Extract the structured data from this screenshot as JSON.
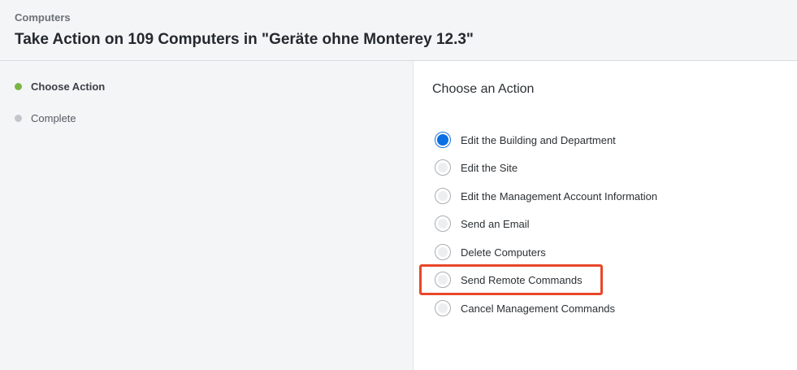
{
  "header": {
    "breadcrumb": "Computers",
    "title": "Take Action on 109 Computers in \"Geräte ohne Monterey 12.3\""
  },
  "steps": [
    {
      "label": "Choose Action",
      "status": "active",
      "color": "#7ab648"
    },
    {
      "label": "Complete",
      "status": "inactive",
      "color": "#c2c5c9"
    }
  ],
  "main": {
    "section_title": "Choose an Action",
    "options": [
      {
        "label": "Edit the Building and Department",
        "selected": true
      },
      {
        "label": "Edit the Site",
        "selected": false
      },
      {
        "label": "Edit the Management Account Information",
        "selected": false
      },
      {
        "label": "Send an Email",
        "selected": false
      },
      {
        "label": "Delete Computers",
        "selected": false
      },
      {
        "label": "Send Remote Commands",
        "selected": false,
        "highlighted": true
      },
      {
        "label": "Cancel Management Commands",
        "selected": false
      }
    ]
  },
  "colors": {
    "selected_radio": "#0a6fe3",
    "highlight_border": "#e8472a",
    "step_active": "#7ab648",
    "step_inactive": "#c2c5c9"
  }
}
